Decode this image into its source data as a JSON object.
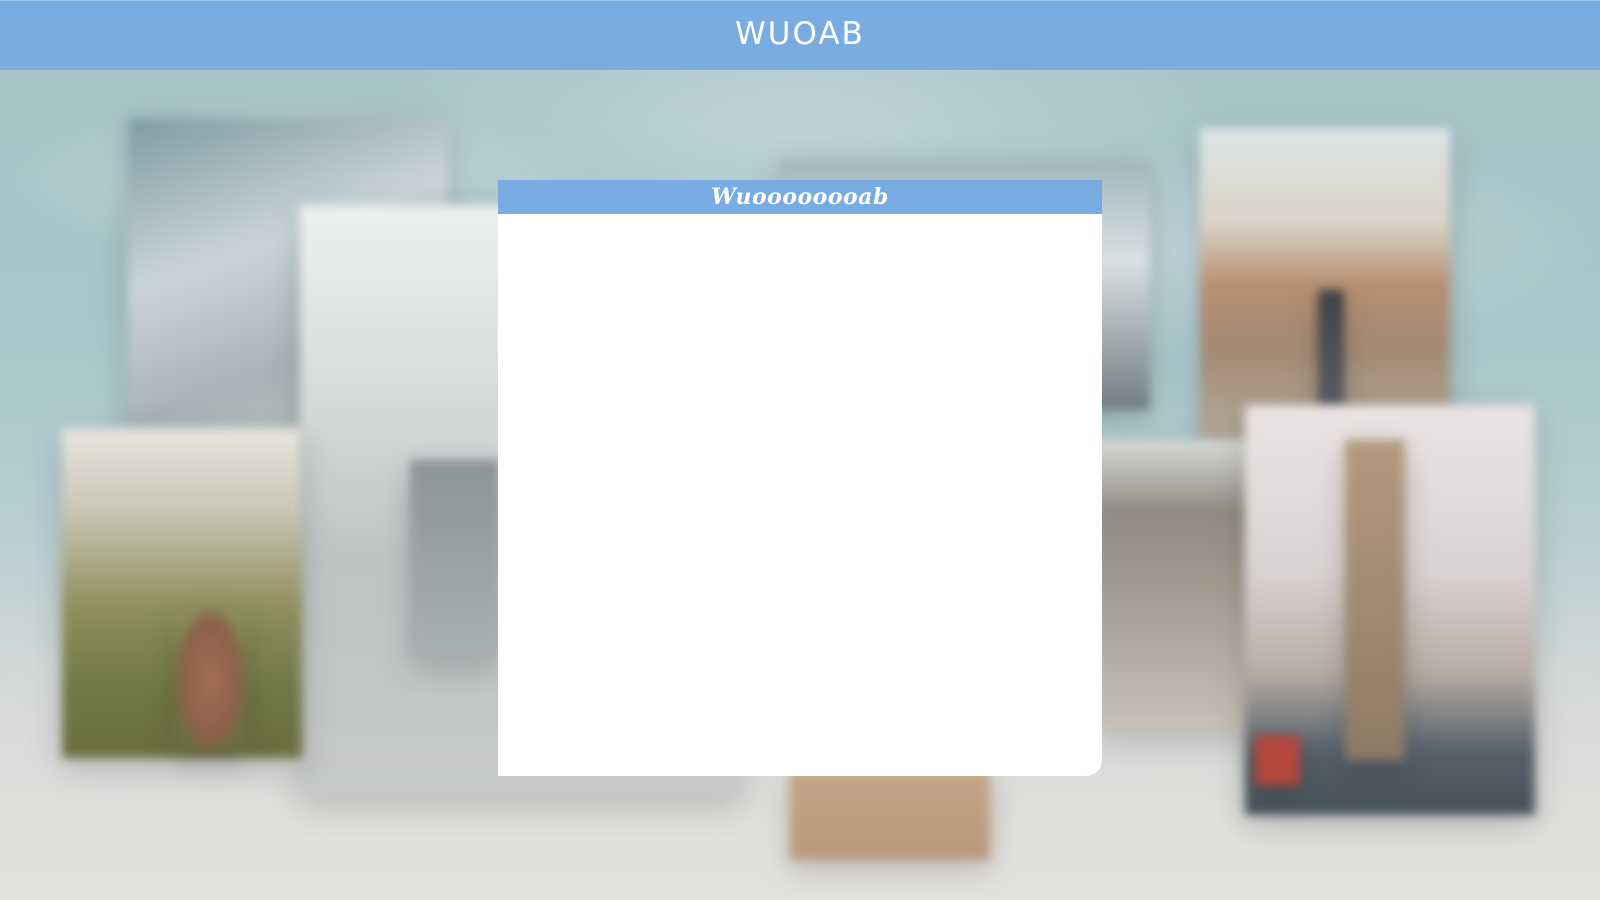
{
  "header": {
    "title": "WUOAB",
    "background_color": "#79ace1",
    "text_color": "#ffffff"
  },
  "card": {
    "title": "Wuoooooooab",
    "bar_color": "#78abe1",
    "body_color": "#ffffff"
  }
}
